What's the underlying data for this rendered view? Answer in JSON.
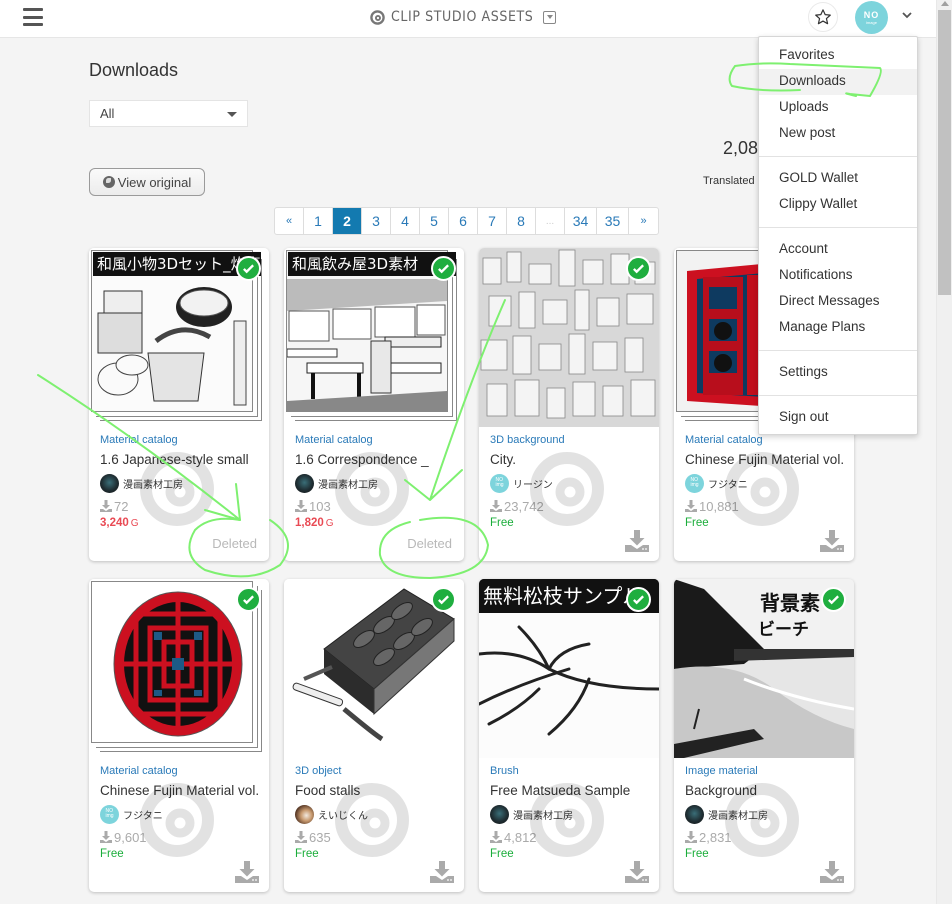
{
  "header": {
    "brand": "CLIP STUDIO ASSETS",
    "avatar_text": "NO",
    "avatar_sub": "image"
  },
  "page": {
    "title": "Downloads",
    "filter": {
      "selected": "All"
    },
    "view_original_label": "View original",
    "count": "2,08",
    "translated_label": "Translated l"
  },
  "pagination": {
    "prev": "«",
    "pages": [
      "1",
      "2",
      "3",
      "4",
      "5",
      "6",
      "7",
      "8",
      "...",
      "34",
      "35"
    ],
    "active": "2",
    "next": "»"
  },
  "colors": {
    "accent": "#137ab0",
    "link": "#2a7ab8",
    "paid": "#e94a54",
    "free": "#1aad3a",
    "check": "#1fae3f",
    "annotation": "#7ef070"
  },
  "cards": [
    {
      "banner": "和風小物3Dセット_炊事",
      "category": "Material catalog",
      "title": "1.6 Japanese-style small",
      "author": "漫画素材工房",
      "author_avatar": "dark",
      "downloads": "72",
      "price": "3,240",
      "price_unit": "G",
      "price_type": "paid",
      "status": "Deleted"
    },
    {
      "banner": "和風飲み屋3D素材",
      "category": "Material catalog",
      "title": "1.6 Correspondence _",
      "author": "漫画素材工房",
      "author_avatar": "dark",
      "downloads": "103",
      "price": "1,820",
      "price_unit": "G",
      "price_type": "paid",
      "status": "Deleted"
    },
    {
      "banner": "",
      "category": "3D background",
      "title": "City.",
      "author": "リージン",
      "author_avatar": "noimg",
      "downloads": "23,742",
      "price": "Free",
      "price_unit": "",
      "price_type": "free",
      "status": ""
    },
    {
      "banner": "",
      "category": "Material catalog",
      "title": "Chinese Fujin Material vol.",
      "author": "フジタニ",
      "author_avatar": "noimg",
      "downloads": "10,881",
      "price": "Free",
      "price_unit": "",
      "price_type": "free",
      "status": ""
    },
    {
      "banner": "",
      "category": "Material catalog",
      "title": "Chinese Fujin Material vol.",
      "author": "フジタニ",
      "author_avatar": "noimg",
      "downloads": "9,601",
      "price": "Free",
      "price_unit": "",
      "price_type": "free",
      "status": ""
    },
    {
      "banner": "",
      "category": "3D object",
      "title": "Food stalls",
      "author": "えいじくん",
      "author_avatar": "photo",
      "downloads": "635",
      "price": "Free",
      "price_unit": "",
      "price_type": "free",
      "status": ""
    },
    {
      "banner": "無料松枝サンプル",
      "category": "Brush",
      "title": "Free Matsueda Sample",
      "author": "漫画素材工房",
      "author_avatar": "dark",
      "downloads": "4,812",
      "price": "Free",
      "price_unit": "",
      "price_type": "free",
      "status": ""
    },
    {
      "banner": "背景素",
      "banner2": "ビーチ",
      "category": "Image material",
      "title": "Background",
      "author": "漫画素材工房",
      "author_avatar": "dark",
      "downloads": "2,831",
      "price": "Free",
      "price_unit": "",
      "price_type": "free",
      "status": ""
    }
  ],
  "menu": {
    "groups": [
      [
        "Favorites",
        "Downloads",
        "Uploads",
        "New post"
      ],
      [
        "GOLD Wallet",
        "Clippy Wallet"
      ],
      [
        "Account",
        "Notifications",
        "Direct Messages",
        "Manage Plans"
      ],
      [
        "Settings"
      ],
      [
        "Sign out"
      ]
    ],
    "current": "Downloads"
  }
}
